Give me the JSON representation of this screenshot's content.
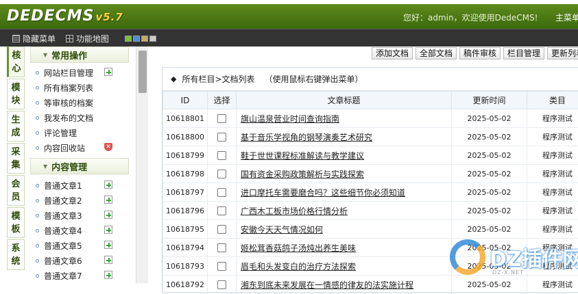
{
  "app": {
    "prev_strip": "1279xx871",
    "logo_text": "DEDECMS",
    "logo_version": "v5.7",
    "greeting": "您好：admin，欢迎使用DedeCMS!",
    "main_page_link": "主菜单"
  },
  "toolbar": {
    "hide_menu": "隐藏菜单",
    "feature_map": "功能地图",
    "swatch_colors": [
      "#7dbf3a",
      "#4a90d9",
      "#c9a86b",
      "#cccccc"
    ]
  },
  "nav_tabs": [
    "核心",
    "模块",
    "生成",
    "采集",
    "会员",
    "模板",
    "系统"
  ],
  "sidebar": {
    "sections": [
      {
        "title": "常用操作",
        "items": [
          {
            "label": "网站栏目管理",
            "action": "add"
          },
          {
            "label": "所有档案列表",
            "action": ""
          },
          {
            "label": "等审核的档案",
            "action": ""
          },
          {
            "label": "我发布的文档",
            "action": ""
          },
          {
            "label": "评论管理",
            "action": ""
          },
          {
            "label": "内容回收站",
            "action": "delete"
          }
        ]
      },
      {
        "title": "内容管理",
        "items": [
          {
            "label": "普通文章1",
            "action": "add"
          },
          {
            "label": "普通文章2",
            "action": "add"
          },
          {
            "label": "普通文章3",
            "action": "add"
          },
          {
            "label": "普通文章4",
            "action": "add"
          },
          {
            "label": "普通文章5",
            "action": "add"
          },
          {
            "label": "普通文章6",
            "action": "add"
          },
          {
            "label": "普通文章7",
            "action": "add"
          }
        ]
      }
    ]
  },
  "actions": [
    "添加文档",
    "全部文档",
    "稿件审核",
    "栏目管理",
    "更新列表"
  ],
  "list": {
    "crumb": "所有栏目>文档列表",
    "hint": "（使用鼠标右键弹出菜单）",
    "columns": [
      "ID",
      "选择",
      "文章标题",
      "更新时间",
      "类目"
    ],
    "rows": [
      {
        "id": "10618801",
        "title": "旗山温泉营业时间查询指南",
        "date": "2025-05-02",
        "cat": "程序测试"
      },
      {
        "id": "10618800",
        "title": "基于音乐学视角的钢琴演奏艺术研究",
        "date": "2025-05-02",
        "cat": "程序测试"
      },
      {
        "id": "10618799",
        "title": "鞋于世世课程标准解读与教学建议",
        "date": "2025-05-02",
        "cat": "程序测试"
      },
      {
        "id": "10618798",
        "title": "国有资金采购政策解析与实践探索",
        "date": "2025-05-02",
        "cat": "程序测试"
      },
      {
        "id": "10618797",
        "title": "进口摩托车需要磨合吗？这些细节你必须知道",
        "date": "2025-05-02",
        "cat": "程序测试"
      },
      {
        "id": "10618796",
        "title": "广西木工板市场价格行情分析",
        "date": "2025-05-02",
        "cat": "程序测试"
      },
      {
        "id": "10618795",
        "title": "安徽今天天气情况如何",
        "date": "2025-05-02",
        "cat": "程序测试"
      },
      {
        "id": "10618794",
        "title": "姬松茸香菇鸽子汤炖出养生美味",
        "date": "2025-05-02",
        "cat": "程序测试"
      },
      {
        "id": "10618793",
        "title": "眉毛和头发变白的治疗方法探索",
        "date": "2025-05-02",
        "cat": "程序测试"
      },
      {
        "id": "10618792",
        "title": "湘东到底未来发展在一情感的律友的法实施计程",
        "date": "2025-05-02",
        "cat": "程序测试"
      }
    ]
  },
  "watermark": {
    "brand": "DZ插件网",
    "url": "DZ-X.NET"
  }
}
